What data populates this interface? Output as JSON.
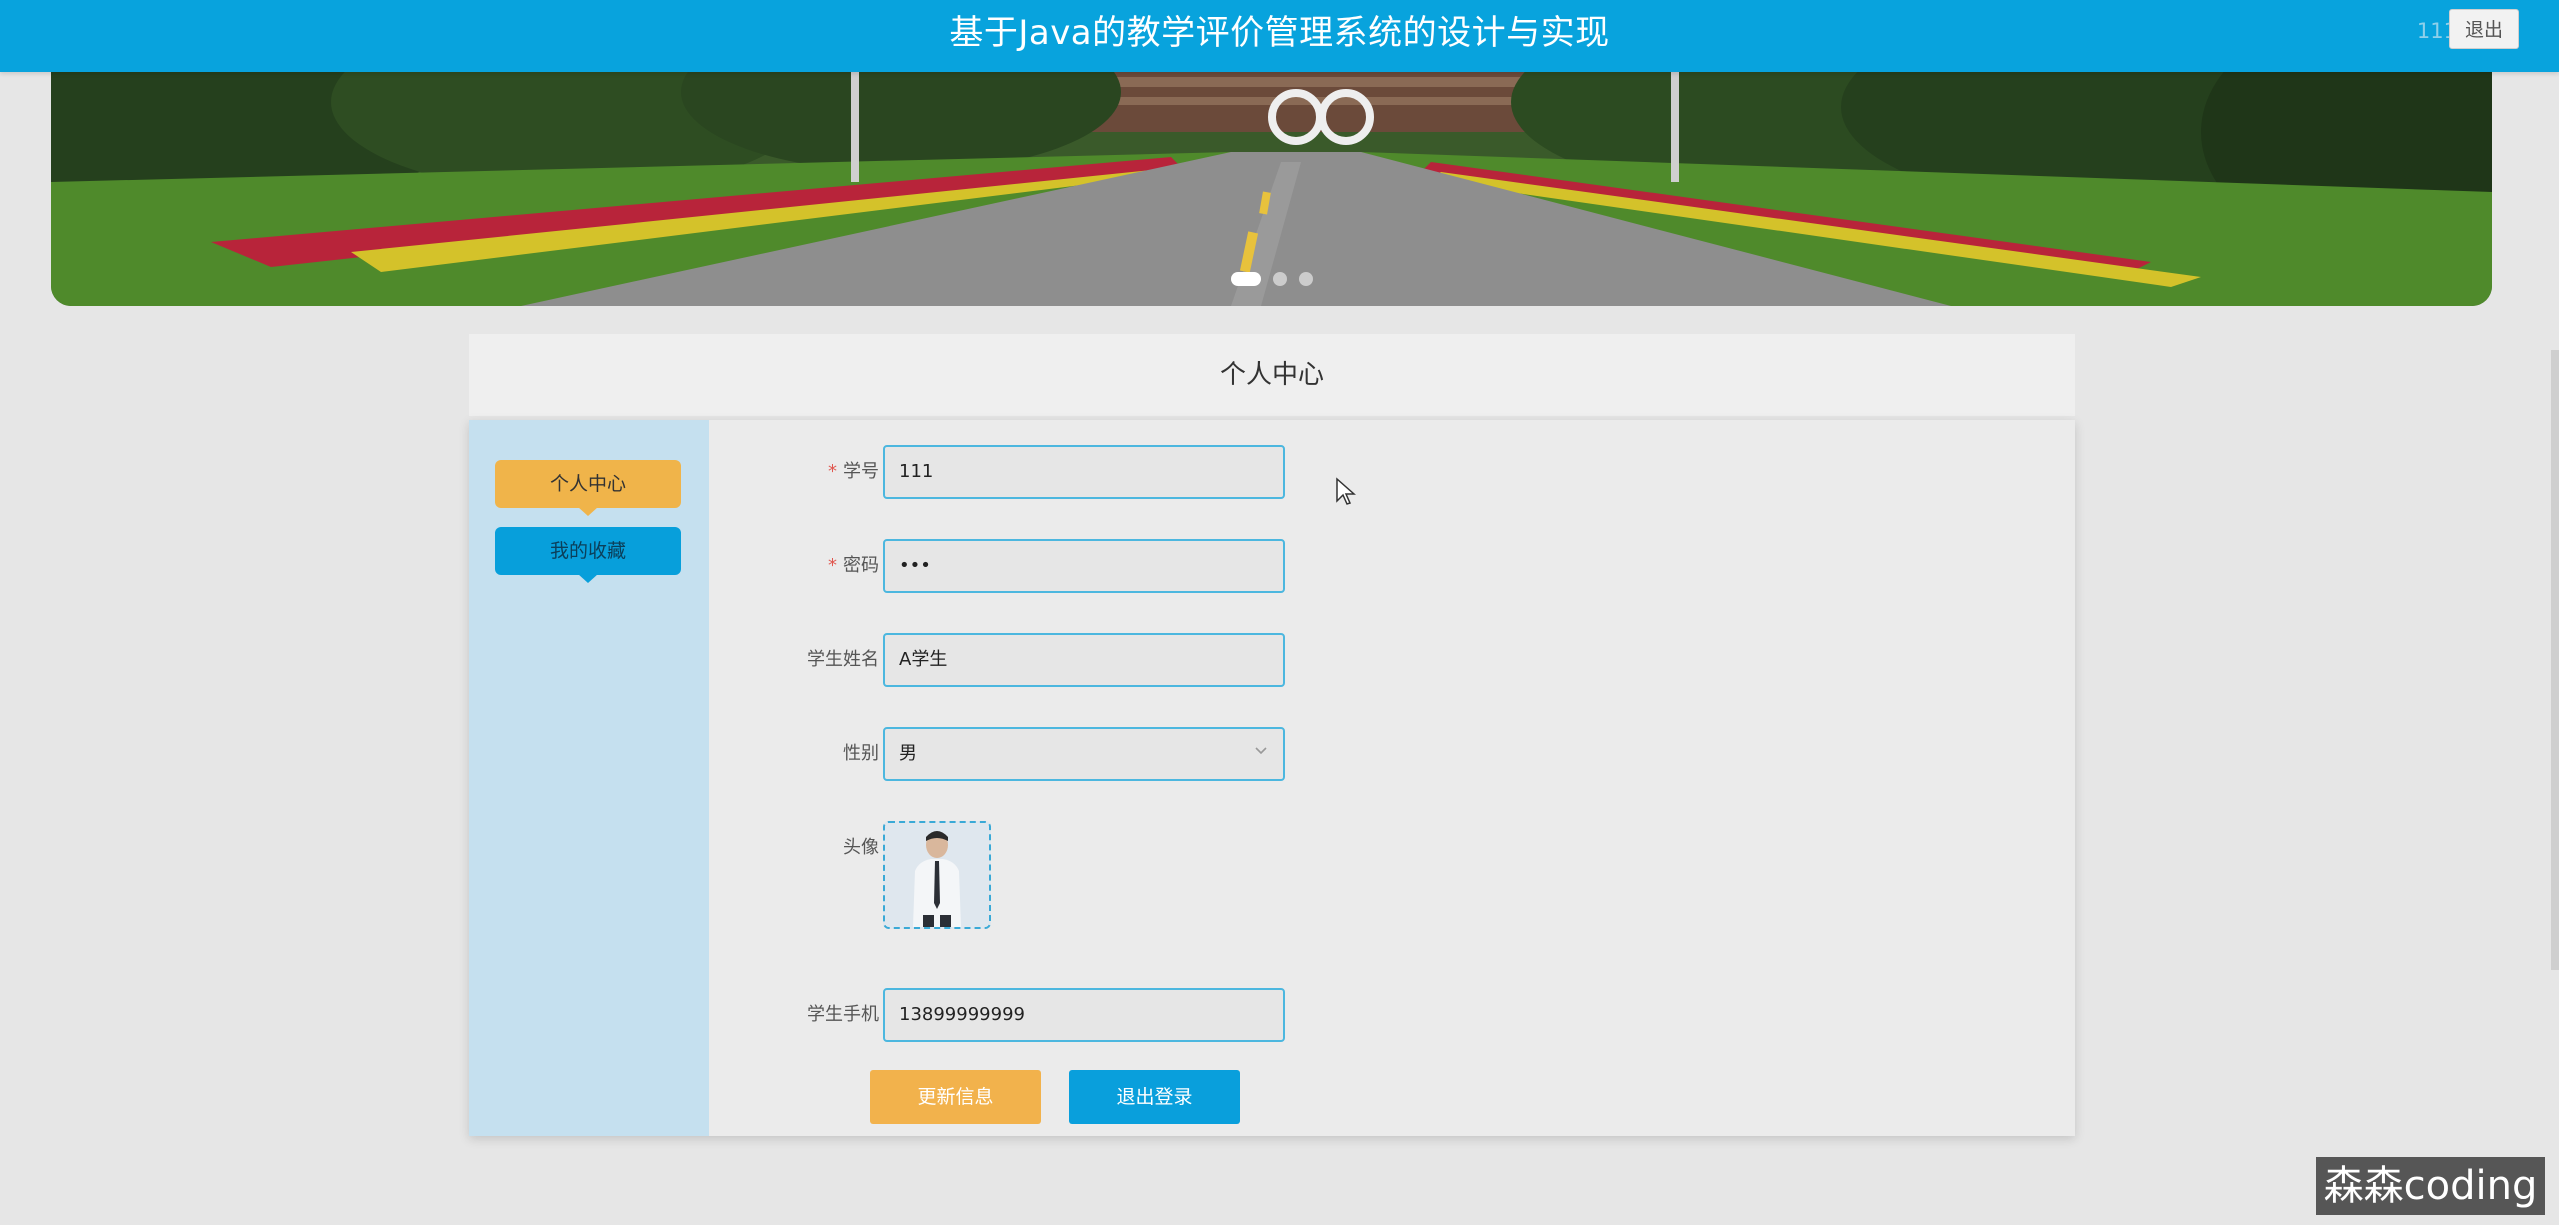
{
  "header": {
    "title": "基于Java的教学评价管理系统的设计与实现",
    "username": "111",
    "logout_label": "退出"
  },
  "banner": {
    "slides": 3,
    "active_slide": 1
  },
  "section": {
    "title": "个人中心"
  },
  "sidebar": {
    "items": [
      {
        "label": "个人中心",
        "active": true
      },
      {
        "label": "我的收藏",
        "active": false
      }
    ]
  },
  "form": {
    "student_id": {
      "label": "学号",
      "required": true,
      "value": "111"
    },
    "password": {
      "label": "密码",
      "required": true,
      "value": "•••"
    },
    "student_name": {
      "label": "学生姓名",
      "required": false,
      "value": "A学生"
    },
    "gender": {
      "label": "性别",
      "value": "男"
    },
    "avatar": {
      "label": "头像"
    },
    "phone": {
      "label": "学生手机",
      "value": "13899999999"
    }
  },
  "actions": {
    "update_label": "更新信息",
    "logout_label": "退出登录"
  },
  "watermark": "森森coding",
  "colors": {
    "header": "#08a3dd",
    "accent_orange": "#f0b44a",
    "accent_blue": "#079fdb",
    "sidebar_bg": "#c5e0ef"
  }
}
